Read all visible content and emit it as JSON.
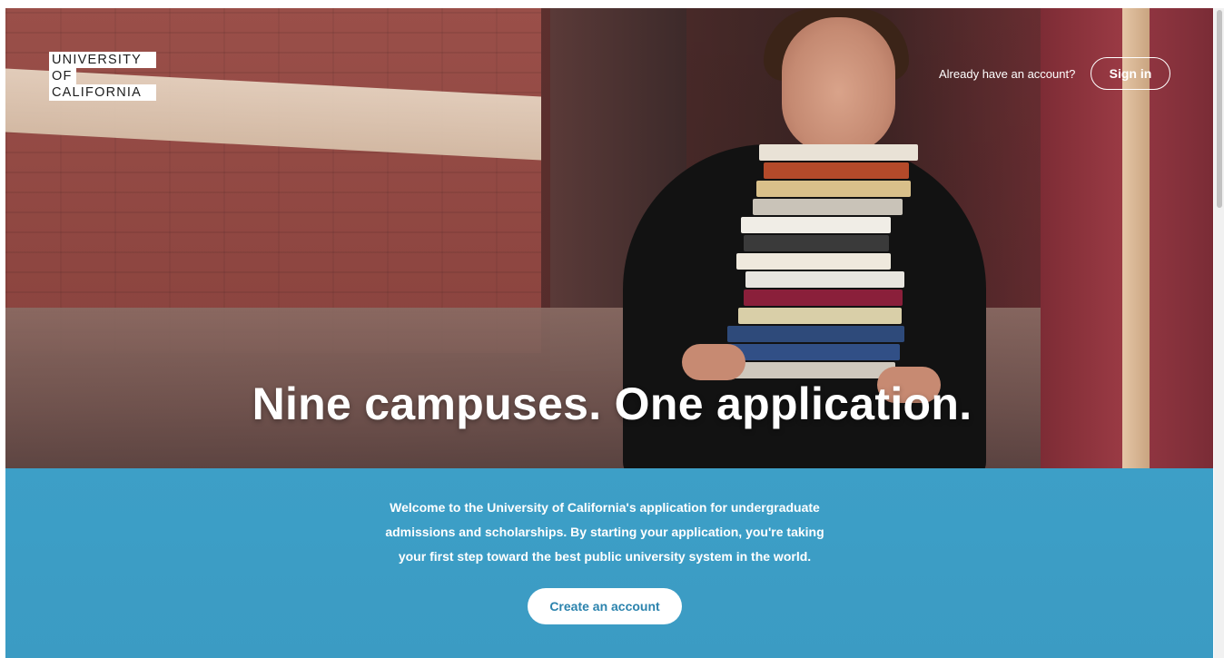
{
  "header": {
    "logo_lines": [
      "UNIVERSITY",
      "OF",
      "CALIFORNIA"
    ],
    "account_prompt": "Already have an account?",
    "signin_label": "Sign in"
  },
  "hero": {
    "headline": "Nine campuses. One application."
  },
  "intro": {
    "line1": "Welcome to the University of California's application for undergraduate",
    "line2": "admissions and scholarships. By starting your application, you're taking",
    "line3": "your first step toward the best public university system in the world."
  },
  "cta": {
    "create_label": "Create an account"
  },
  "colors": {
    "blue_section": "#3d9fc7",
    "cta_text": "#2b83ad",
    "white": "#ffffff"
  }
}
